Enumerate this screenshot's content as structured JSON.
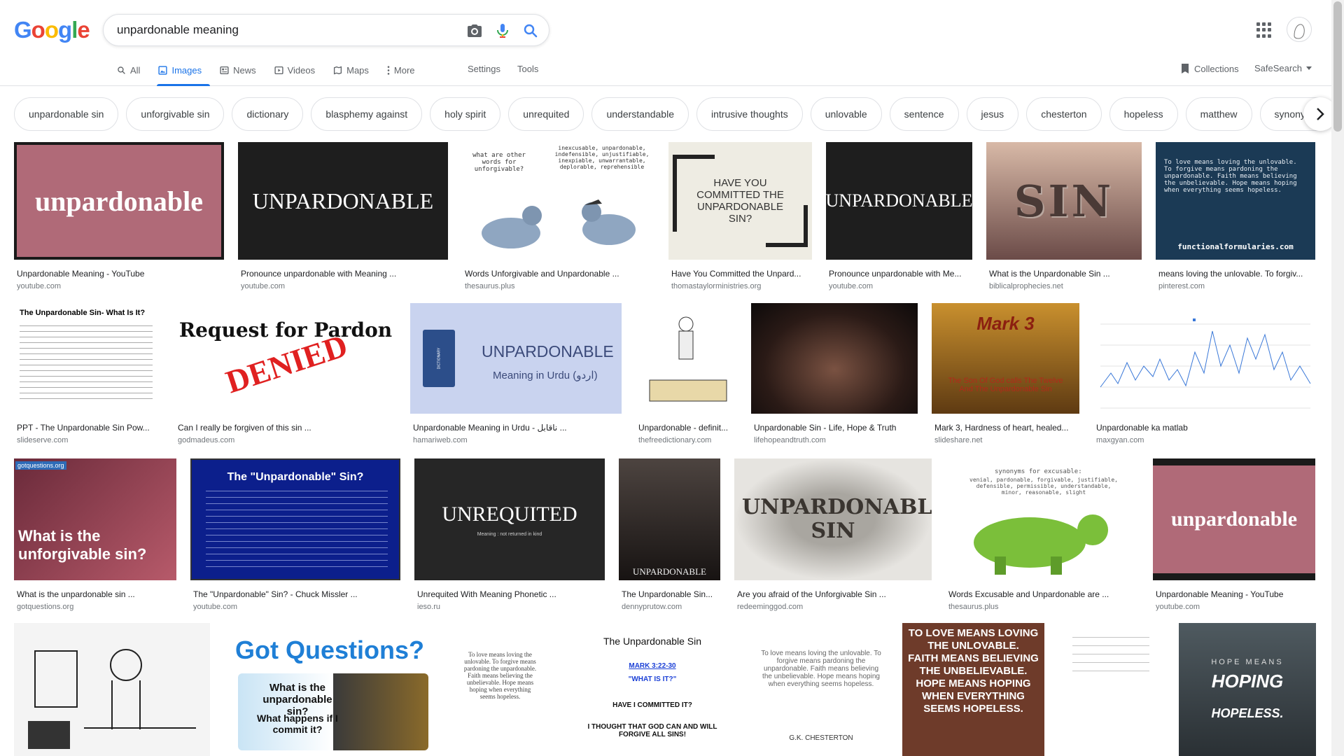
{
  "header": {
    "query": "unpardonable meaning",
    "logo": "Google"
  },
  "tabs": [
    {
      "label": "All",
      "icon": "search-icon"
    },
    {
      "label": "Images",
      "icon": "image-icon"
    },
    {
      "label": "News",
      "icon": "news-icon"
    },
    {
      "label": "Videos",
      "icon": "video-icon"
    },
    {
      "label": "Maps",
      "icon": "map-icon"
    },
    {
      "label": "More",
      "icon": "more-vert-icon"
    }
  ],
  "tools": {
    "settings": "Settings",
    "tools": "Tools",
    "collections": "Collections",
    "safesearch": "SafeSearch"
  },
  "chips": [
    "unpardonable sin",
    "unforgivable sin",
    "dictionary",
    "blasphemy against",
    "holy spirit",
    "unrequited",
    "understandable",
    "intrusive thoughts",
    "unlovable",
    "sentence",
    "jesus",
    "chesterton",
    "hopeless",
    "matthew",
    "synonyms"
  ],
  "results": [
    {
      "title": "Unpardonable Meaning - YouTube",
      "source": "youtube.com",
      "text": "unpardonable"
    },
    {
      "title": "Pronounce unpardonable with Meaning ...",
      "source": "youtube.com",
      "text": "UNPARDONABLE"
    },
    {
      "title": "Words Unforgivable and Unpardonable ...",
      "source": "thesaurus.plus",
      "text": "what are other words for unforgivable?"
    },
    {
      "title": "Have You Committed the Unpard...",
      "source": "thomastaylorministries.org",
      "text": "HAVE YOU COMMITTED THE UNPARDONABLE SIN?"
    },
    {
      "title": "Pronounce unpardonable with Me...",
      "source": "youtube.com",
      "text": "UNPARDONABLE"
    },
    {
      "title": "What is the Unpardonable Sin ...",
      "source": "biblicalprophecies.net",
      "text": "SIN"
    },
    {
      "title": "means loving the unlovable. To forgiv...",
      "source": "pinterest.com",
      "text": "functionalformularies.com"
    },
    {
      "title": "PPT - The Unpardonable Sin Pow...",
      "source": "slideserve.com",
      "text": "The Unpardonable Sin- What Is It?"
    },
    {
      "title": "Can I really be forgiven of this sin ...",
      "source": "godmadeus.com",
      "text": "Request for Pardon"
    },
    {
      "title": "Unpardonable Meaning in Urdu - ناقابل ...",
      "source": "hamariweb.com",
      "text": "UNPARDONABLE"
    },
    {
      "title": "Unpardonable - definit...",
      "source": "thefreedictionary.com",
      "text": ""
    },
    {
      "title": "Unpardonable Sin - Life, Hope & Truth",
      "source": "lifehopeandtruth.com",
      "text": ""
    },
    {
      "title": "Mark 3, Hardness of heart, healed...",
      "source": "slideshare.net",
      "text": "Mark 3"
    },
    {
      "title": "Unpardonable ka matlab",
      "source": "maxgyan.com",
      "text": ""
    },
    {
      "title": "What is the unpardonable sin ...",
      "source": "gotquestions.org",
      "text": "What is the unforgivable sin?"
    },
    {
      "title": "The \"Unpardonable\" Sin? - Chuck Missler ...",
      "source": "youtube.com",
      "text": "The \"Unpardonable\" Sin?"
    },
    {
      "title": "Unrequited With Meaning Phonetic ...",
      "source": "ieso.ru",
      "text": "UNREQUITED"
    },
    {
      "title": "The Unpardonable Sin...",
      "source": "dennyprutow.com",
      "text": "UNPARDONABLE"
    },
    {
      "title": "Are you afraid of the Unforgivable Sin ...",
      "source": "redeeminggod.com",
      "text": "UNPARDONABLE SIN"
    },
    {
      "title": "Words Excusable and Unpardonable are ...",
      "source": "thesaurus.plus",
      "text": "synonyms for excusable:"
    },
    {
      "title": "Unpardonable Meaning - YouTube",
      "source": "youtube.com",
      "text": "unpardonable"
    },
    {
      "title": "",
      "source": "",
      "text": ""
    },
    {
      "title": "",
      "source": "",
      "text": "Got Questions?"
    },
    {
      "title": "",
      "source": "",
      "text": "To love means loving the unlovable."
    },
    {
      "title": "",
      "source": "",
      "text": "The Unpardonable Sin"
    },
    {
      "title": "",
      "source": "",
      "text": "G.K. CHESTERTON"
    },
    {
      "title": "",
      "source": "",
      "text": "TO LOVE MEANS LOVING THE UNLOVABLE."
    },
    {
      "title": "",
      "source": "",
      "text": ""
    },
    {
      "title": "",
      "source": "",
      "text": "HOPING"
    }
  ],
  "extra_text": {
    "urdu_sub": "Meaning in Urdu (اردو)",
    "denied": "DENIED",
    "gotq_sub1": "What is the unpardonable sin?",
    "gotq_sub2": "What happens if I commit it?",
    "mark_ref": "MARK 3:22-30",
    "what_is_it": "\"WHAT IS IT?\"",
    "committed": "HAVE I COMMITTED IT?",
    "forgive": "I THOUGHT THAT GOD CAN AND WILL FORGIVE ALL SINS!",
    "hope_means": "HOPE MEANS",
    "hopeless": "HOPELESS.",
    "chesterton_quote": "To love means loving the unlovable. To forgive means pardoning the unpardonable. Faith means believing the unbelievable. Hope means hoping when everything seems hopeless.",
    "chesterton_sig": "— G.K. Chesterton",
    "faith_means": "FAITH MEANS BELIEVING THE UNBELIEVABLE. HOPE MEANS HOPING WHEN EVERYTHING SEEMS HOPELESS.",
    "unforgivable_words": "inexcusable, unpardonable, indefensible, unjustifiable, inexpiable, unwarrantable, deplorable, reprehensible",
    "excusable_words": "venial, pardonable, forgivable, justifiable, defensible, permissible, understandable, minor, reasonable, slight",
    "son_of_god": "The Son Of God calls The Twelve And The Unpardonable Sin",
    "unrequited_meaning": "Meaning : not returned in kind",
    "dictionary_book": "DICTIONARY"
  }
}
